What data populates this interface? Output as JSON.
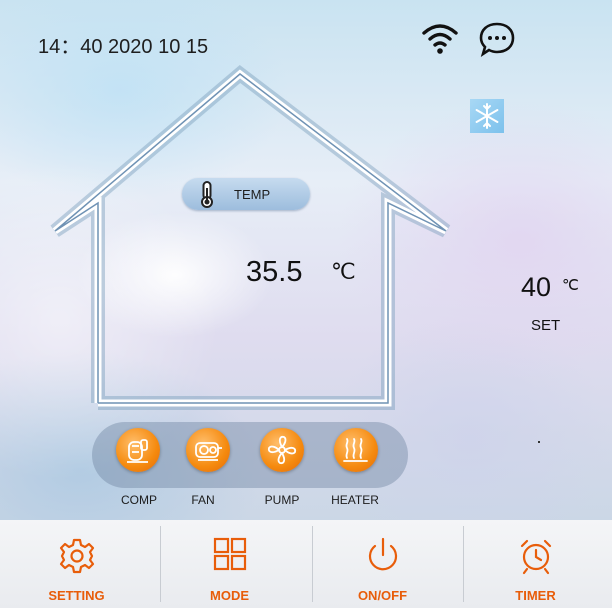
{
  "status_bar": {
    "datetime": "14：40 2020 10 15",
    "icons": [
      "wifi-icon",
      "message-icon"
    ]
  },
  "mode_indicator": {
    "icon": "snowflake-icon",
    "color": "#7cc1ec"
  },
  "current_temp": {
    "label": "TEMP",
    "value": "35.5",
    "unit": "℃"
  },
  "set_temp": {
    "value": "40",
    "unit": "℃",
    "label": "SET"
  },
  "devices": [
    {
      "label": "COMP",
      "icon": "compressor-icon"
    },
    {
      "label": "FAN",
      "icon": "fan-icon"
    },
    {
      "label": "PUMP",
      "icon": "pump-icon"
    },
    {
      "label": "HEATER",
      "icon": "heater-icon"
    }
  ],
  "bottom_nav": [
    {
      "label": "SETTING",
      "icon": "gear-icon"
    },
    {
      "label": "MODE",
      "icon": "mode-grid-icon"
    },
    {
      "label": "ON/OFF",
      "icon": "power-icon"
    },
    {
      "label": "TIMER",
      "icon": "alarm-clock-icon"
    }
  ],
  "colors": {
    "accent": "#e85d0a",
    "device_orange": "#f58a0e",
    "house_outline": "#ffffff",
    "pill": "#a9c6e3"
  }
}
